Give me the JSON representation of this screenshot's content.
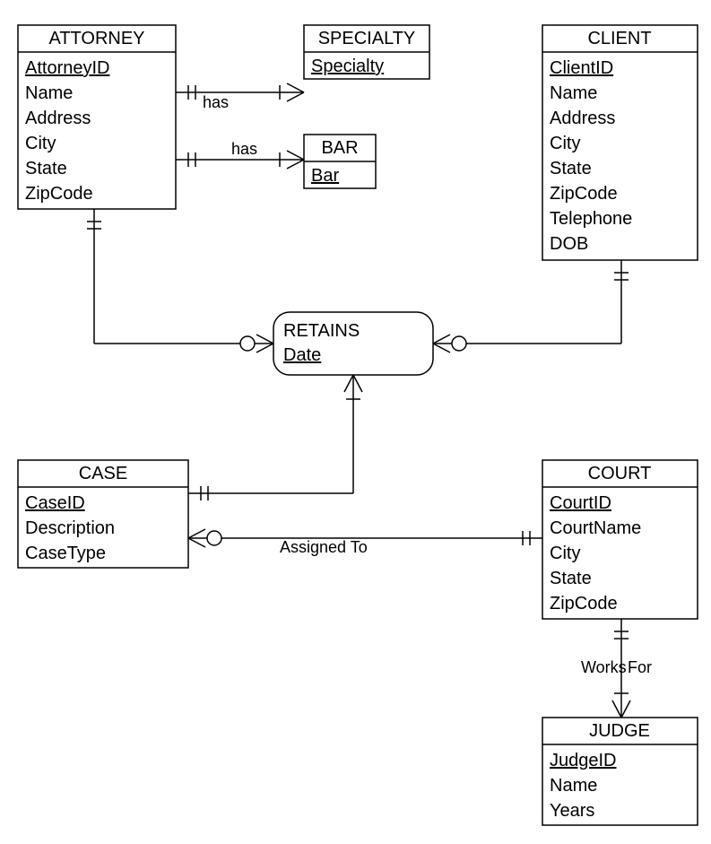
{
  "entities": {
    "attorney": {
      "title": "ATTORNEY",
      "attrs": [
        "AttorneyID",
        "Name",
        "Address",
        "City",
        "State",
        "ZipCode"
      ],
      "keys": [
        0
      ]
    },
    "specialty": {
      "title": "SPECIALTY",
      "attrs": [
        "Specialty"
      ],
      "keys": [
        0
      ]
    },
    "bar": {
      "title": "BAR",
      "attrs": [
        "Bar"
      ],
      "keys": [
        0
      ]
    },
    "client": {
      "title": "CLIENT",
      "attrs": [
        "ClientID",
        "Name",
        "Address",
        "City",
        "State",
        "ZipCode",
        "Telephone",
        "DOB"
      ],
      "keys": [
        0
      ]
    },
    "case": {
      "title": "CASE",
      "attrs": [
        "CaseID",
        "Description",
        "CaseType"
      ],
      "keys": [
        0
      ]
    },
    "court": {
      "title": "COURT",
      "attrs": [
        "CourtID",
        "CourtName",
        "City",
        "State",
        "ZipCode"
      ],
      "keys": [
        0
      ]
    },
    "judge": {
      "title": "JUDGE",
      "attrs": [
        "JudgeID",
        "Name",
        "Years"
      ],
      "keys": [
        0
      ]
    }
  },
  "relationships": {
    "retains": {
      "title": "RETAINS",
      "attr": "Date"
    },
    "has_specialty": {
      "label": "has"
    },
    "has_bar": {
      "label": "has"
    },
    "assigned_to": {
      "label": "Assigned To"
    },
    "works_for": {
      "label": "Works For"
    }
  }
}
